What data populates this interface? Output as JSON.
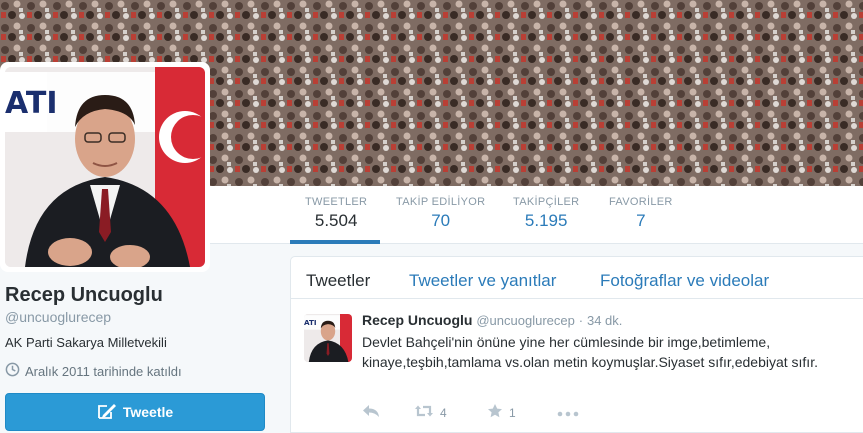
{
  "profile": {
    "name": "Recep Uncuoglu",
    "handle": "@uncuoglurecep",
    "bio": "AK Parti Sakarya Milletvekili",
    "joined": "Aralık 2011 tarihinde katıldı",
    "tweet_button": "Tweetle",
    "avatar_sign_text": "ATI"
  },
  "stats": [
    {
      "label": "TWEETLER",
      "value": "5.504",
      "active": true
    },
    {
      "label": "TAKİP EDİLİYOR",
      "value": "70"
    },
    {
      "label": "TAKİPÇİLER",
      "value": "5.195"
    },
    {
      "label": "FAVORİLER",
      "value": "7"
    }
  ],
  "tabs": [
    {
      "label": "Tweetler",
      "active": true
    },
    {
      "label": "Tweetler ve yanıtlar"
    },
    {
      "label": "Fotoğraflar ve videolar"
    }
  ],
  "tweet": {
    "name": "Recep Uncuoglu",
    "handle": "@uncuoglurecep",
    "separator": "·",
    "time": "34 dk.",
    "text": "Devlet Bahçeli'nin önüne yine her cümlesinde bir imge,betimleme, kinaye,teşbih,tamlama vs.olan metin koymuşlar.Siyaset sıfır,edebiyat sıfır.",
    "retweets": "4",
    "favorites": "1",
    "avatar_sign_text": "ATI"
  },
  "colors": {
    "link": "#2b7bb9",
    "tweet_button": "#2b9ad6",
    "muted": "#8899a6"
  },
  "icons": [
    "clock-icon",
    "compose-icon",
    "reply-icon",
    "retweet-icon",
    "favorite-icon",
    "more-icon"
  ]
}
